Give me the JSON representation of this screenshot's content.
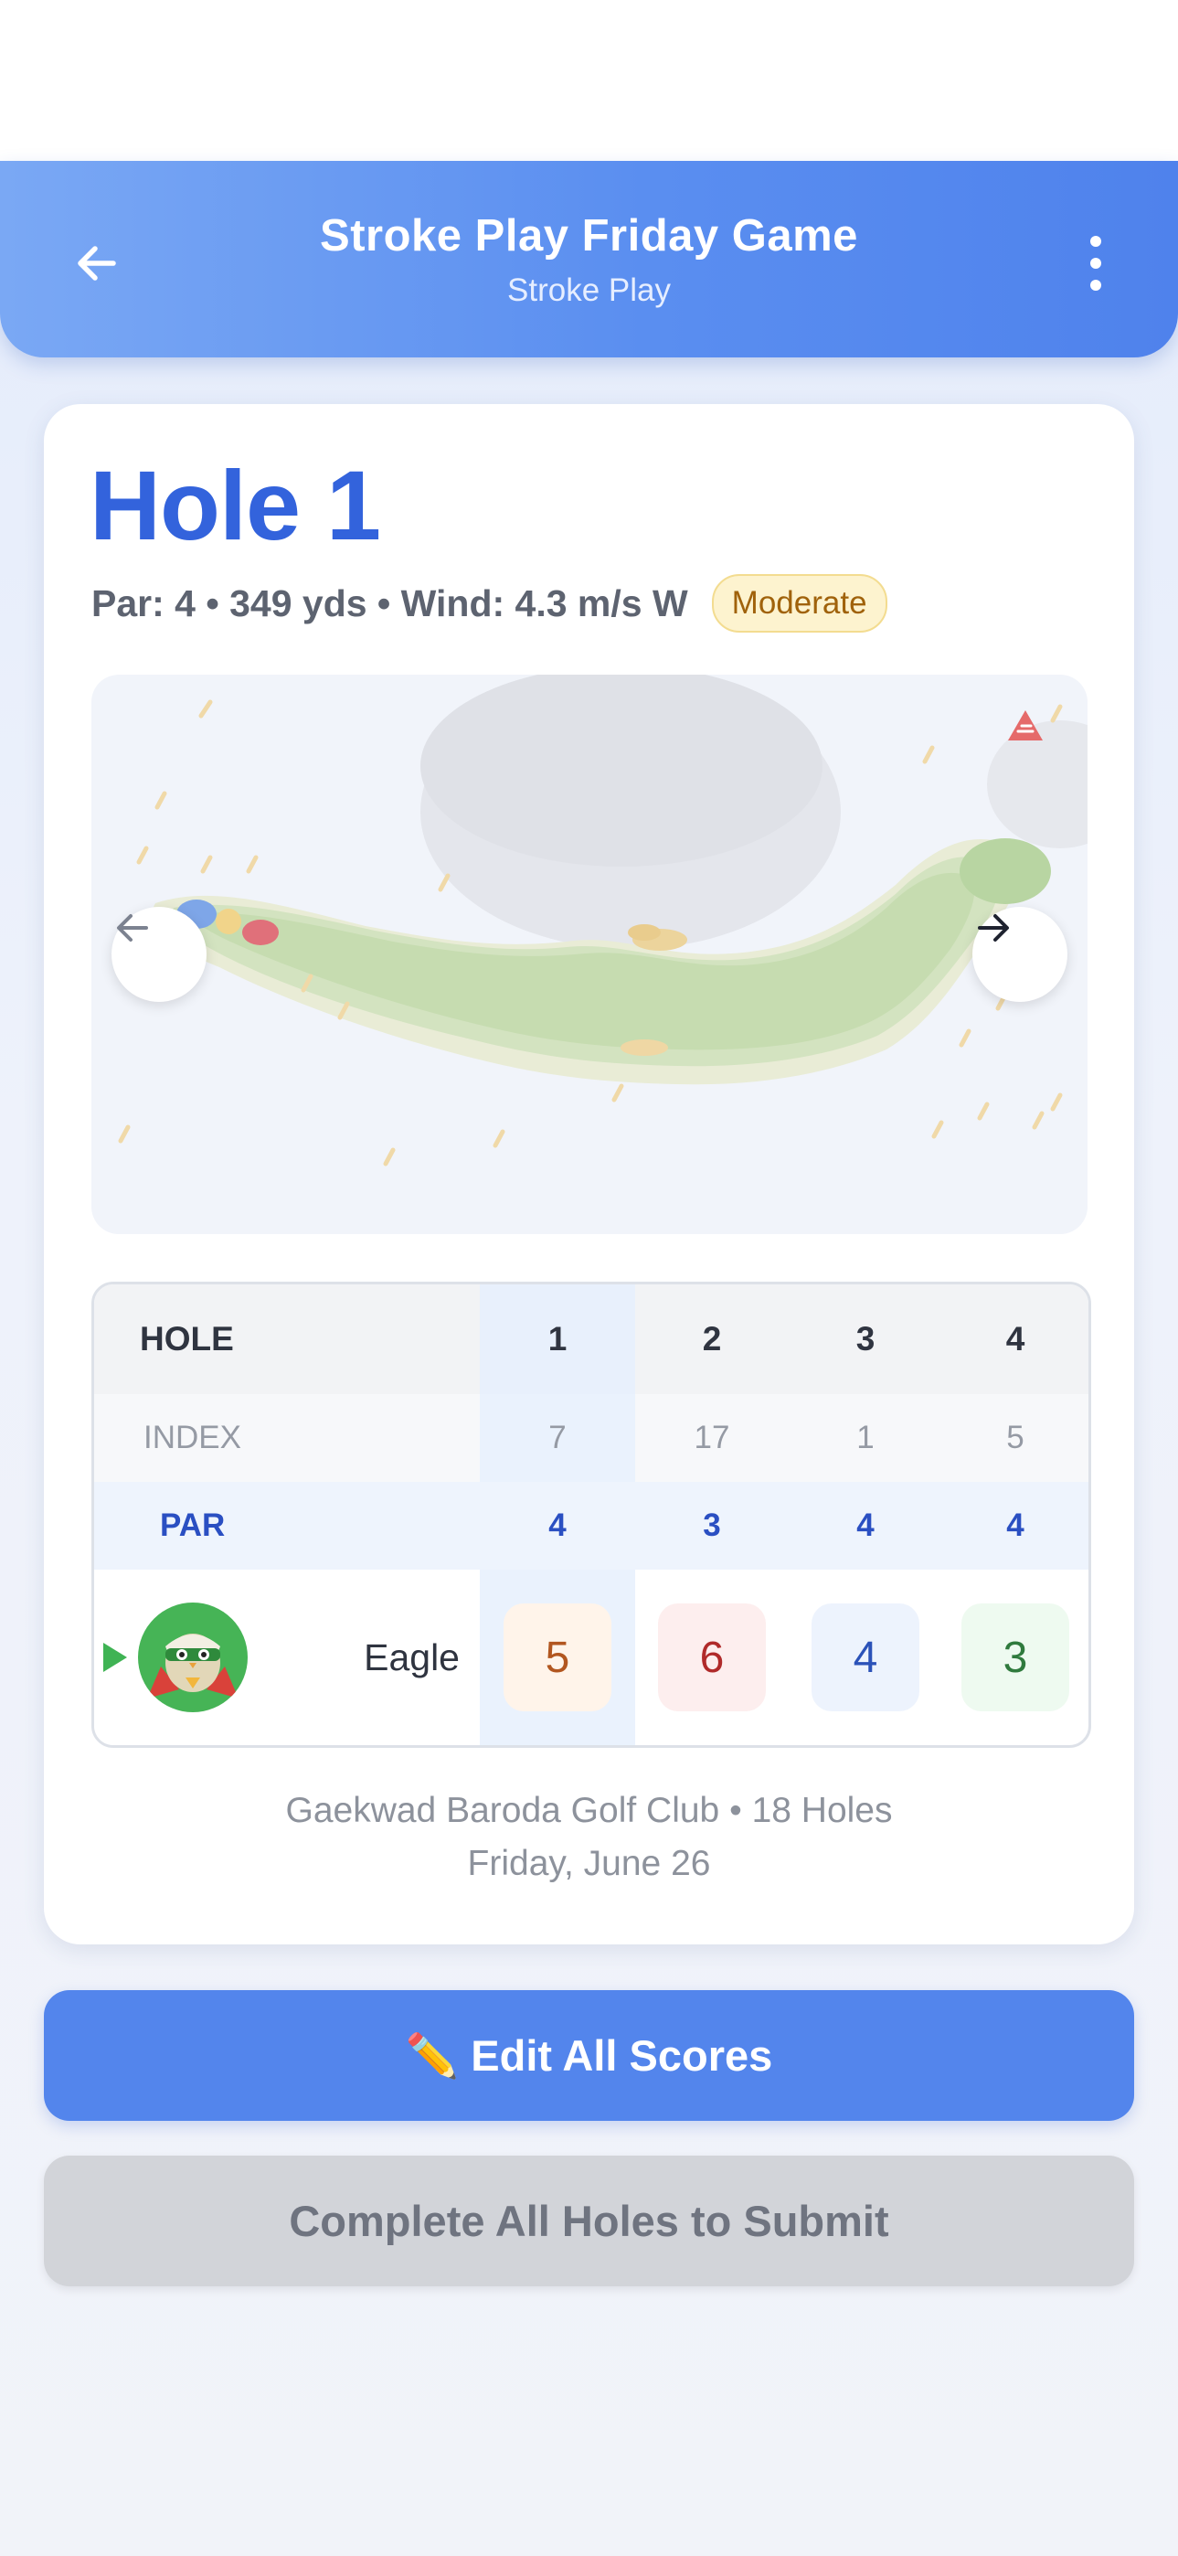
{
  "header": {
    "title": "Stroke Play Friday Game",
    "subtitle": "Stroke Play"
  },
  "hole": {
    "title": "Hole 1",
    "meta": "Par: 4 • 349 yds • Wind: 4.3 m/s W",
    "wind_badge": "Moderate"
  },
  "scorecard": {
    "header_label": "HOLE",
    "index_label": "INDEX",
    "par_label": "PAR",
    "holes": [
      "1",
      "2",
      "3",
      "4"
    ],
    "index": [
      "7",
      "17",
      "1",
      "5"
    ],
    "par": [
      "4",
      "3",
      "4",
      "4"
    ],
    "player": {
      "name": "Eagle",
      "scores": [
        "5",
        "6",
        "4",
        "3"
      ]
    },
    "score_colors": {
      "bogey": "#fff4ea",
      "double_bogey": "#fdeeee",
      "par": "#edf3fd",
      "birdie": "#eefaf0"
    }
  },
  "course": {
    "line": "Gaekwad Baroda Golf Club • 18 Holes",
    "date": "Friday, June 26"
  },
  "actions": {
    "edit_label": "✏️ Edit All Scores",
    "submit_label": "Complete All Holes to Submit"
  },
  "colors": {
    "accent": "#4f82ec",
    "hole_title": "#3363dc",
    "par_text": "#2a4fc2"
  },
  "icons": {
    "back": "arrow-left-icon",
    "menu": "more-vertical-icon",
    "prev": "arrow-left-icon",
    "next": "arrow-right-icon",
    "wind": "wind-warning-icon"
  }
}
